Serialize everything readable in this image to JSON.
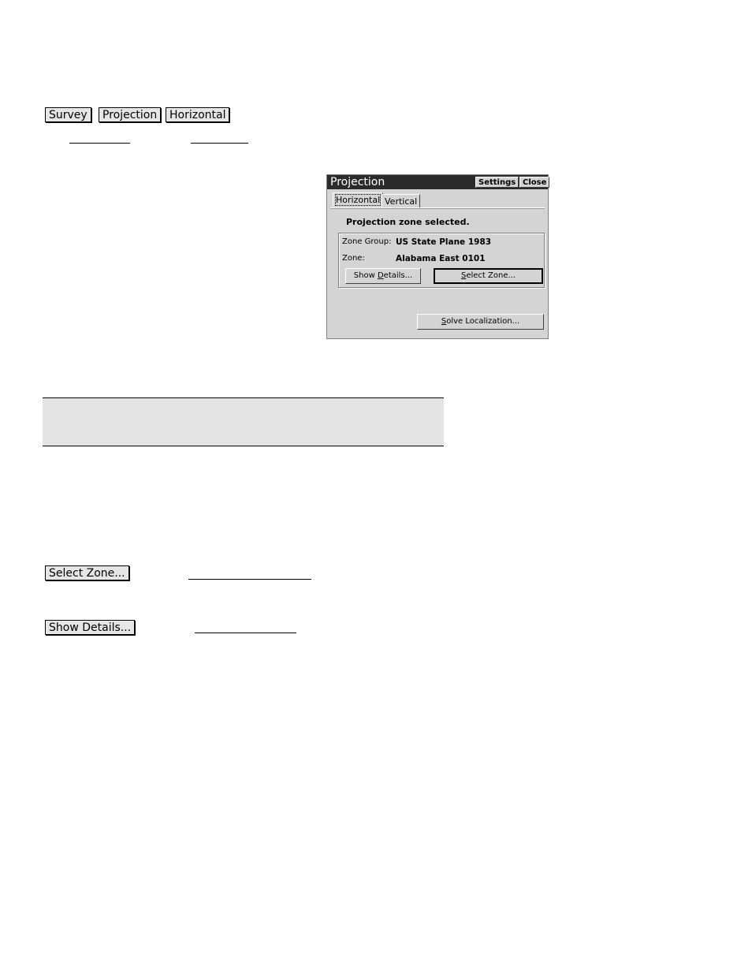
{
  "breadcrumb": {
    "items": [
      {
        "label": "Survey"
      },
      {
        "label": "Projection"
      },
      {
        "label": "Horizontal"
      }
    ]
  },
  "dialog": {
    "title": "Projection",
    "settings_label": "Settings",
    "close_label": "Close",
    "tabs": [
      {
        "label": "Horizontal",
        "active": true
      },
      {
        "label": "Vertical",
        "active": false
      }
    ],
    "status": "Projection zone selected.",
    "zone_group_label": "Zone Group:",
    "zone_group_value": "US State Plane 1983",
    "zone_label": "Zone:",
    "zone_value": "Alabama East 0101",
    "show_details": {
      "pre": "Show ",
      "accel": "D",
      "post": "etails..."
    },
    "select_zone": {
      "pre": "",
      "accel": "S",
      "post": "elect Zone..."
    },
    "solve_localization": {
      "pre": "",
      "accel": "S",
      "post": "olve Localization..."
    }
  },
  "keys": {
    "select_zone": "Select Zone...",
    "show_details": "Show Details..."
  }
}
